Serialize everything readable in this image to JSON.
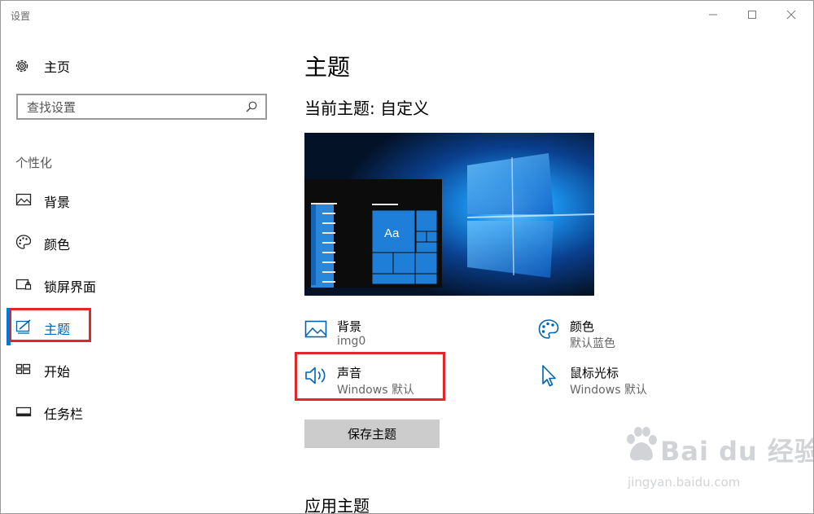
{
  "window": {
    "title": "设置",
    "controls": {
      "minimize_icon": "minimize-icon",
      "maximize_icon": "maximize-icon",
      "close_icon": "close-icon"
    }
  },
  "sidebar": {
    "home_label": "主页",
    "search_placeholder": "查找设置",
    "section_title": "个性化",
    "items": [
      {
        "label": "背景",
        "icon": "picture-icon",
        "active": false
      },
      {
        "label": "颜色",
        "icon": "palette-icon",
        "active": false
      },
      {
        "label": "锁屏界面",
        "icon": "lock-screen-icon",
        "active": false
      },
      {
        "label": "主题",
        "icon": "theme-brush-icon",
        "active": true
      },
      {
        "label": "开始",
        "icon": "start-grid-icon",
        "active": false
      },
      {
        "label": "任务栏",
        "icon": "taskbar-icon",
        "active": false
      }
    ]
  },
  "main": {
    "page_title": "主题",
    "current_theme_label": "当前主题: 自定义",
    "preview": {
      "tile_text": "Aa"
    },
    "attributes": {
      "background": {
        "title": "背景",
        "value": "img0"
      },
      "color": {
        "title": "颜色",
        "value": "默认蓝色"
      },
      "sound": {
        "title": "声音",
        "value": "Windows 默认"
      },
      "cursor": {
        "title": "鼠标光标",
        "value": "Windows 默认"
      }
    },
    "save_button": "保存主题",
    "apply_theme_heading": "应用主题"
  },
  "watermark": {
    "brand": "Bai du 经验",
    "url": "jingyan.baidu.com"
  },
  "colors": {
    "accent": "#0078d7",
    "highlight_box": "#e4262a",
    "button_bg": "#cccccc"
  }
}
